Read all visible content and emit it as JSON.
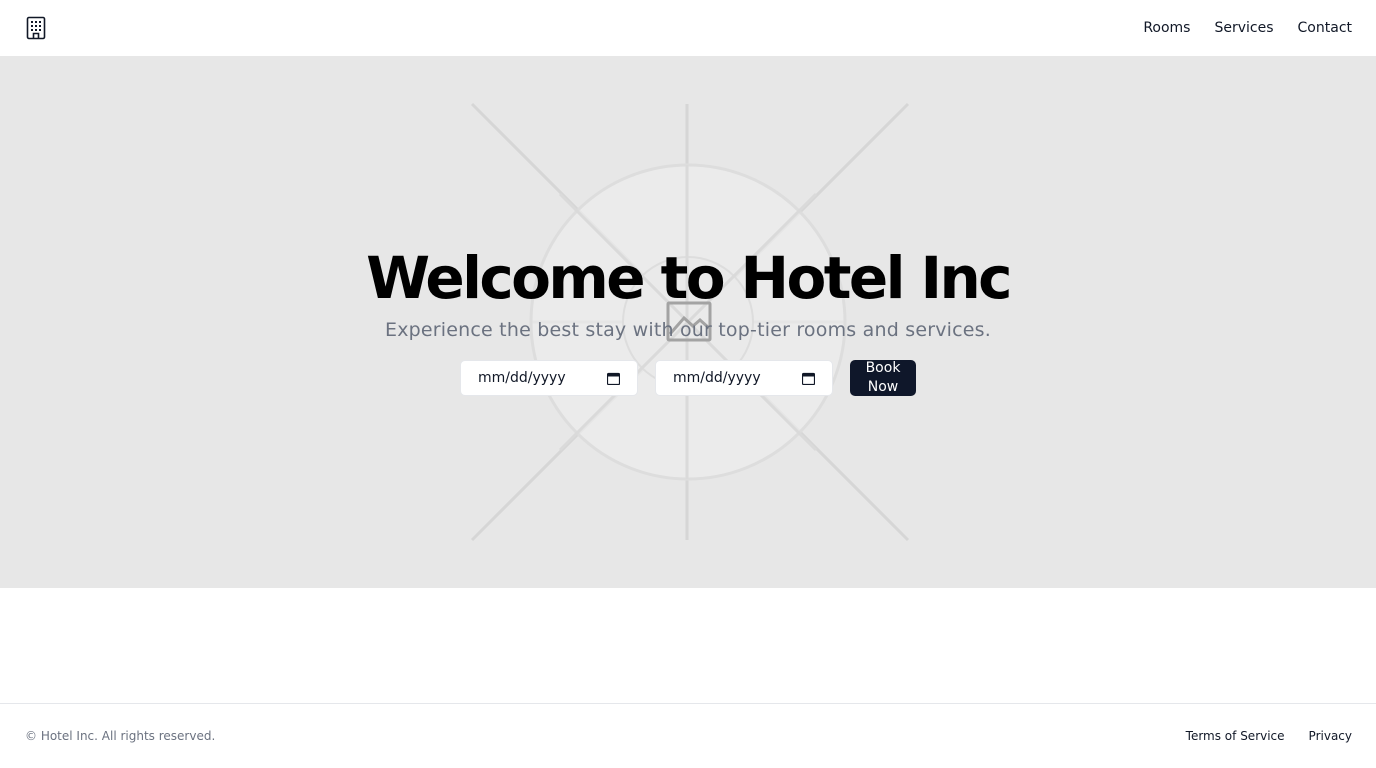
{
  "header": {
    "logo_icon": "building-icon",
    "nav": [
      {
        "label": "Rooms"
      },
      {
        "label": "Services"
      },
      {
        "label": "Contact"
      }
    ]
  },
  "hero": {
    "title": "Welcome to Hotel Inc",
    "subtitle": "Experience the best stay with our top-tier rooms and services.",
    "background_icon": "image-placeholder-icon",
    "checkin_placeholder": "mm/dd/yyyy",
    "checkout_placeholder": "mm/dd/yyyy",
    "date_icon": "calendar-icon",
    "book_button": "Book Now"
  },
  "footer": {
    "copyright": "© Hotel Inc. All rights reserved.",
    "links": [
      {
        "label": "Terms of Service"
      },
      {
        "label": "Privacy"
      }
    ]
  },
  "colors": {
    "hero_bg": "#e7e7e7",
    "button_bg": "#0f172a",
    "subtitle": "#6b7280"
  }
}
